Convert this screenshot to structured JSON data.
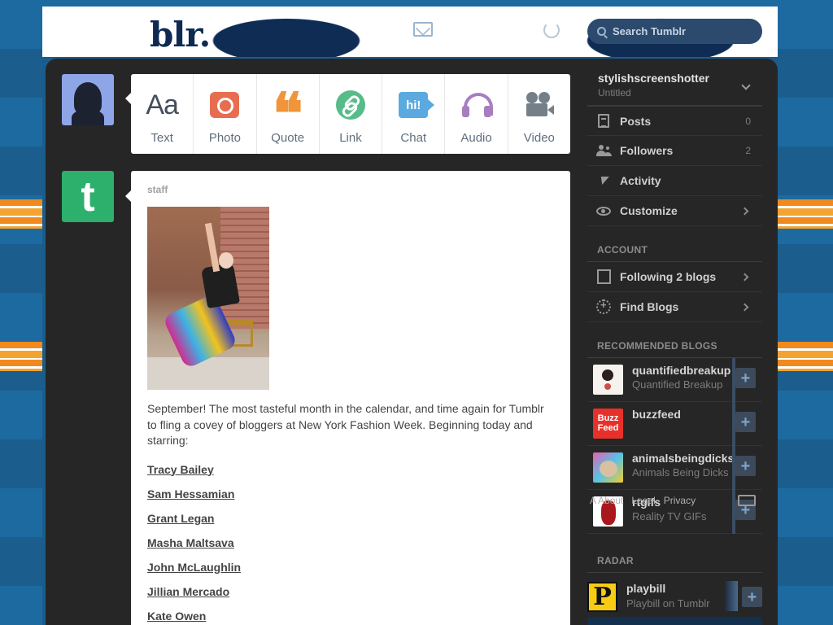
{
  "header": {
    "logo_fragment": "blr.",
    "search_placeholder": "Search Tumblr"
  },
  "post_types": [
    {
      "key": "text",
      "label": "Text",
      "glyph": "Aa"
    },
    {
      "key": "photo",
      "label": "Photo"
    },
    {
      "key": "quote",
      "label": "Quote",
      "glyph": "❝"
    },
    {
      "key": "link",
      "label": "Link"
    },
    {
      "key": "chat",
      "label": "Chat",
      "glyph": "hi!"
    },
    {
      "key": "audio",
      "label": "Audio"
    },
    {
      "key": "video",
      "label": "Video"
    }
  ],
  "post": {
    "author": "staff",
    "staff_avatar_letter": "t",
    "body": "September! The most tasteful month in the calendar, and time again for Tumblr to fling a covey of bloggers at New York Fashion Week. Beginning today and starring:",
    "names": [
      "Tracy Bailey",
      "Sam Hessamian",
      "Grant Legan",
      "Masha Maltsava",
      "John McLaughlin",
      "Jillian Mercado",
      "Kate Owen"
    ]
  },
  "sidebar": {
    "blog_name": "stylishscreenshotter",
    "blog_title": "Untitled",
    "nav": [
      {
        "label": "Posts",
        "count": "0",
        "icon": "posts-icon"
      },
      {
        "label": "Followers",
        "count": "2",
        "icon": "followers-icon"
      },
      {
        "label": "Activity",
        "icon": "activity-icon"
      },
      {
        "label": "Customize",
        "icon": "customize-icon"
      }
    ],
    "account_title": "ACCOUNT",
    "account": [
      {
        "label": "Following 2 blogs",
        "icon": "following-icon"
      },
      {
        "label": "Find Blogs",
        "icon": "find-blogs-icon"
      }
    ],
    "recommended_title": "RECOMMENDED BLOGS",
    "recommended": [
      {
        "name": "quantifiedbreakup",
        "sub": "Quantified Breakup"
      },
      {
        "name": "buzzfeed",
        "sub": "",
        "avatar_text": "Buzz Feed"
      },
      {
        "name": "animalsbeingdicks",
        "sub": "Animals Being Dicks"
      },
      {
        "name": "rtgifs",
        "sub": "Reality TV GIFs"
      }
    ],
    "footer_links": [
      "A",
      "About",
      "Legal",
      "Privacy"
    ],
    "radar_title": "RADAR",
    "radar": {
      "name": "playbill",
      "sub": "Playbill on Tumblr",
      "avatar_letter": "P"
    },
    "follow_glyph": "+"
  },
  "colors": {
    "panel": "#262626",
    "staff_green": "#2cb06c",
    "photo_red": "#e76d51",
    "quote_orange": "#f0953a",
    "link_green": "#56bc8a",
    "chat_blue": "#5aa9df",
    "audio_purple": "#a77dc2",
    "video_gray": "#748089"
  }
}
